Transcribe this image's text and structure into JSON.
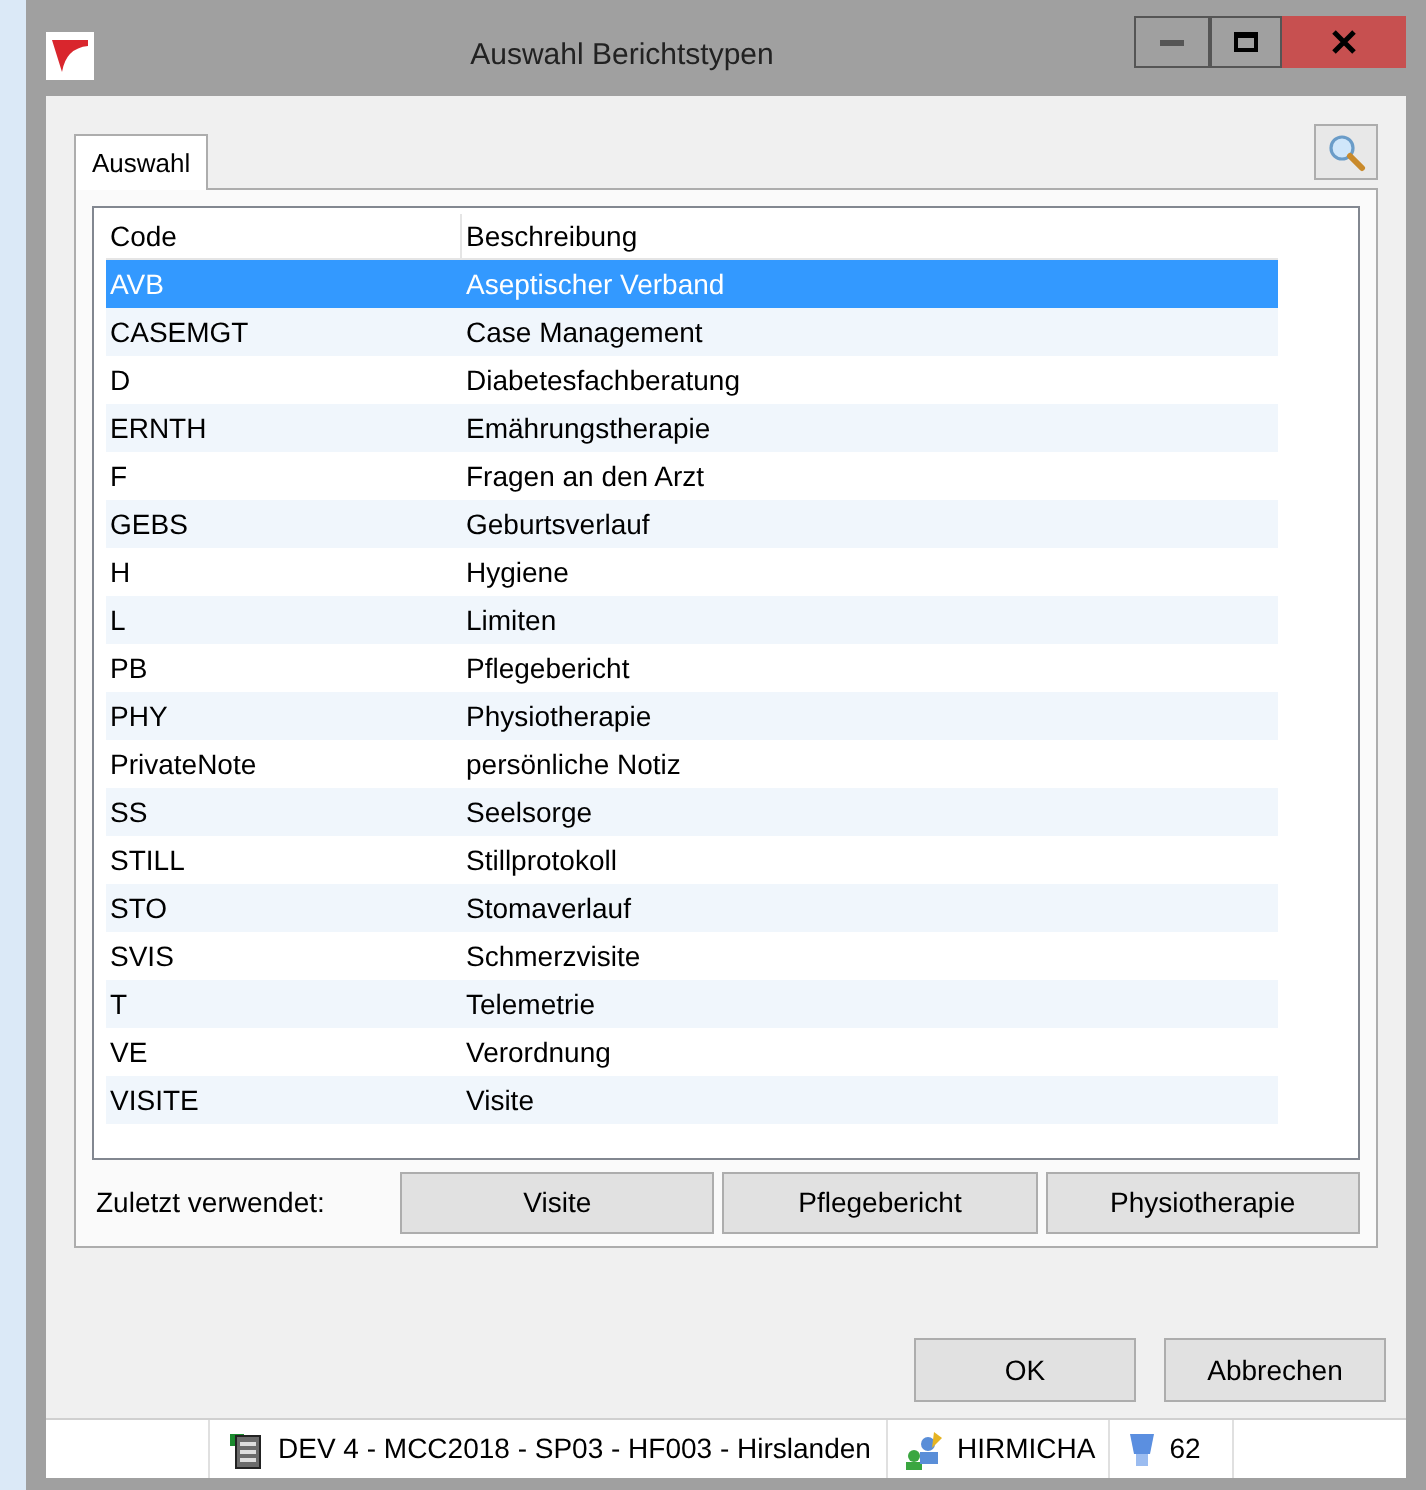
{
  "window": {
    "title": "Auswahl Berichtstypen"
  },
  "tabs": [
    {
      "label": "Auswahl",
      "selected": true
    }
  ],
  "table": {
    "columns": [
      "Code",
      "Beschreibung"
    ],
    "rows": [
      {
        "code": "AVB",
        "description": "Aseptischer Verband",
        "selected": true
      },
      {
        "code": "CASEMGT",
        "description": "Case Management",
        "selected": false
      },
      {
        "code": "D",
        "description": "Diabetesfachberatung",
        "selected": false
      },
      {
        "code": "ERNTH",
        "description": "Emährungstherapie",
        "selected": false
      },
      {
        "code": "F",
        "description": "Fragen an den Arzt",
        "selected": false
      },
      {
        "code": "GEBS",
        "description": "Geburtsverlauf",
        "selected": false
      },
      {
        "code": "H",
        "description": "Hygiene",
        "selected": false
      },
      {
        "code": "L",
        "description": "Limiten",
        "selected": false
      },
      {
        "code": "PB",
        "description": "Pflegebericht",
        "selected": false
      },
      {
        "code": "PHY",
        "description": "Physiotherapie",
        "selected": false
      },
      {
        "code": "PrivateNote",
        "description": "persönliche Notiz",
        "selected": false
      },
      {
        "code": "SS",
        "description": "Seelsorge",
        "selected": false
      },
      {
        "code": "STILL",
        "description": "Stillprotokoll",
        "selected": false
      },
      {
        "code": "STO",
        "description": "Stomaverlauf",
        "selected": false
      },
      {
        "code": "SVIS",
        "description": "Schmerzvisite",
        "selected": false
      },
      {
        "code": "T",
        "description": "Telemetrie",
        "selected": false
      },
      {
        "code": "VE",
        "description": "Verordnung",
        "selected": false
      },
      {
        "code": "VISITE",
        "description": "Visite",
        "selected": false
      }
    ]
  },
  "recent": {
    "label": "Zuletzt verwendet:",
    "buttons": [
      "Visite",
      "Pflegebericht",
      "Physiotherapie"
    ]
  },
  "buttons": [
    "OK",
    "Abbrechen"
  ],
  "status_bar": {
    "connection": "DEV 4 - MCC2018 - SP03 - HF003 - Hirslanden",
    "user": "HIRMICHA",
    "count": "62"
  }
}
